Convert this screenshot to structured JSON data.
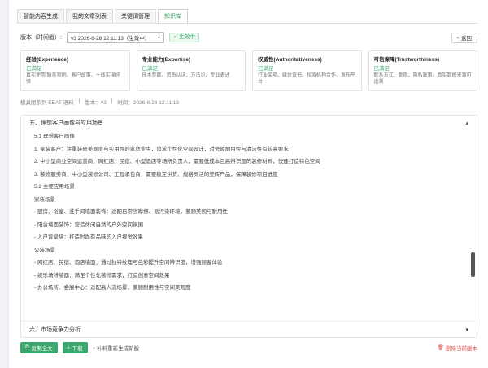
{
  "tabs": [
    {
      "label": "智能内容生成"
    },
    {
      "label": "我的文章列表"
    },
    {
      "label": "关键词管理"
    },
    {
      "label": "知识库"
    }
  ],
  "version": {
    "label": "版本（时间戳）:",
    "selected": "v3 2026-8-28 12:11:13（生效中）",
    "status": "生效中",
    "back": "返回"
  },
  "cards": [
    {
      "title": "经验(Experience)",
      "status": "已满足",
      "desc": "真实使用/服务案例、客户故事、一线实操经验"
    },
    {
      "title": "专业能力(Expertise)",
      "status": "已满足",
      "desc": "技术参数、资质认证、方法论、专业表述"
    },
    {
      "title": "权威性(Authoritativeness)",
      "status": "已满足",
      "desc": "行业奖项、媒体背书、权威机构合作、发布平台"
    },
    {
      "title": "可信保障(Trustworthiness)",
      "status": "已满足",
      "desc": "联系方式、复盘、隐私政策、真实数据来源可追溯"
    }
  ],
  "meta": {
    "source": "模具图系列 EEAT 语料",
    "sep1": "|",
    "version": "版本：v3",
    "sep2": "|",
    "time": "时间：2026-8-28 12:11:13"
  },
  "content": {
    "section_title": "五、理想客户画像与应用场景",
    "lines": [
      "5.1 理想客户画像",
      "1. 家装客户：注重装修美观度与实用性的家庭业主，追求个性化空间设计，对瓷砖耐用性与清洁性有较高要求",
      "2. 中小型商业空间运营商：网红店、民宿、小型酒店等场所负责人，需要低成本且高辨识度的装修材料，快速打造特色空间",
      "3. 装修服务商：中小型装修公司、工程承包商，需要稳定供货、规格灵活的瓷砖产品，保障装修项目进度",
      "5.2 主要应用场景",
      "家装场景",
      "- 厨房、浴室、洗手间墙面装饰：适配日常高摩擦、易污染环境，兼顾美观与耐用性",
      "- 阳台墙面装饰：营造休闲自然的户外空间氛围",
      "- 入户背景墙：打造时尚有品味的入户视觉效果",
      "公装场景",
      "- 网红店、民宿、酒店墙面：通过独特纹理与色彩提升空间辨识度，增强顾客体验",
      "- 娱乐场所墙面：满足个性化装修需求，打造创意空间效果",
      "- 办公场所、会展中心：适配高人流场景，兼顾耐用性与空间美观度"
    ],
    "next_section": "六、市场竞争力分析"
  },
  "footer": {
    "copy": "复制全文",
    "download": "下载",
    "regenerate": "+ 补料重新生成新版",
    "delete": "删除当前版本"
  },
  "colors": {
    "accent": "#3aa76d",
    "danger": "#e05252"
  }
}
